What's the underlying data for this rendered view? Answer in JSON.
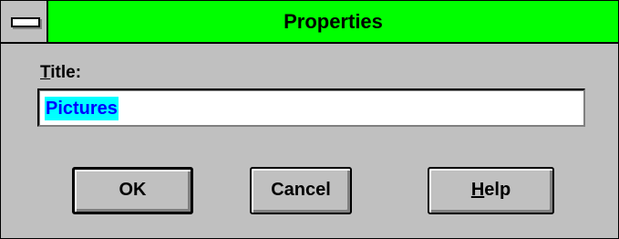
{
  "window": {
    "title": "Properties",
    "accent_color": "#00ff00",
    "system_menu_icon": "minus-icon"
  },
  "form": {
    "title_label_underlined": "T",
    "title_label_rest": "itle:",
    "title_value": "Pictures"
  },
  "buttons": {
    "ok_label": "OK",
    "cancel_label": "Cancel",
    "help_label_underlined": "H",
    "help_label_rest": "elp"
  }
}
